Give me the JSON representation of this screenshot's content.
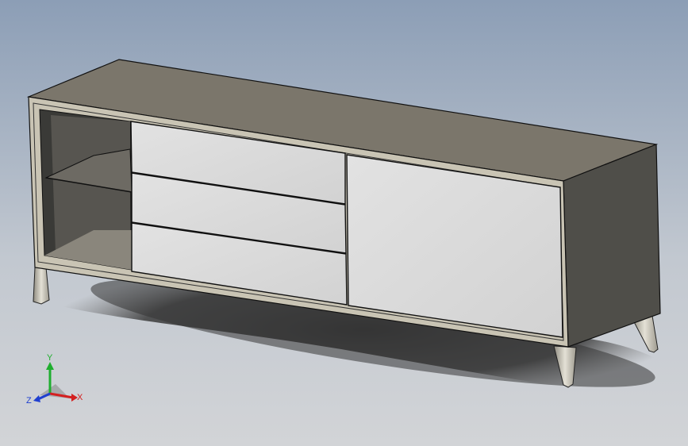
{
  "viewport": {
    "background_top": "#8c9eb6",
    "background_bottom": "#d2d4d7"
  },
  "model": {
    "body_color": "#7a756a",
    "drawer_color": "#d7d7d7",
    "leg_color": "#c8c4b4",
    "shadow_color": "#3e3e3e"
  },
  "triad": {
    "x_label": "X",
    "y_label": "Y",
    "z_label": "Z",
    "x_color": "#d42020",
    "y_color": "#1fae2f",
    "z_color": "#1f3fd0"
  }
}
